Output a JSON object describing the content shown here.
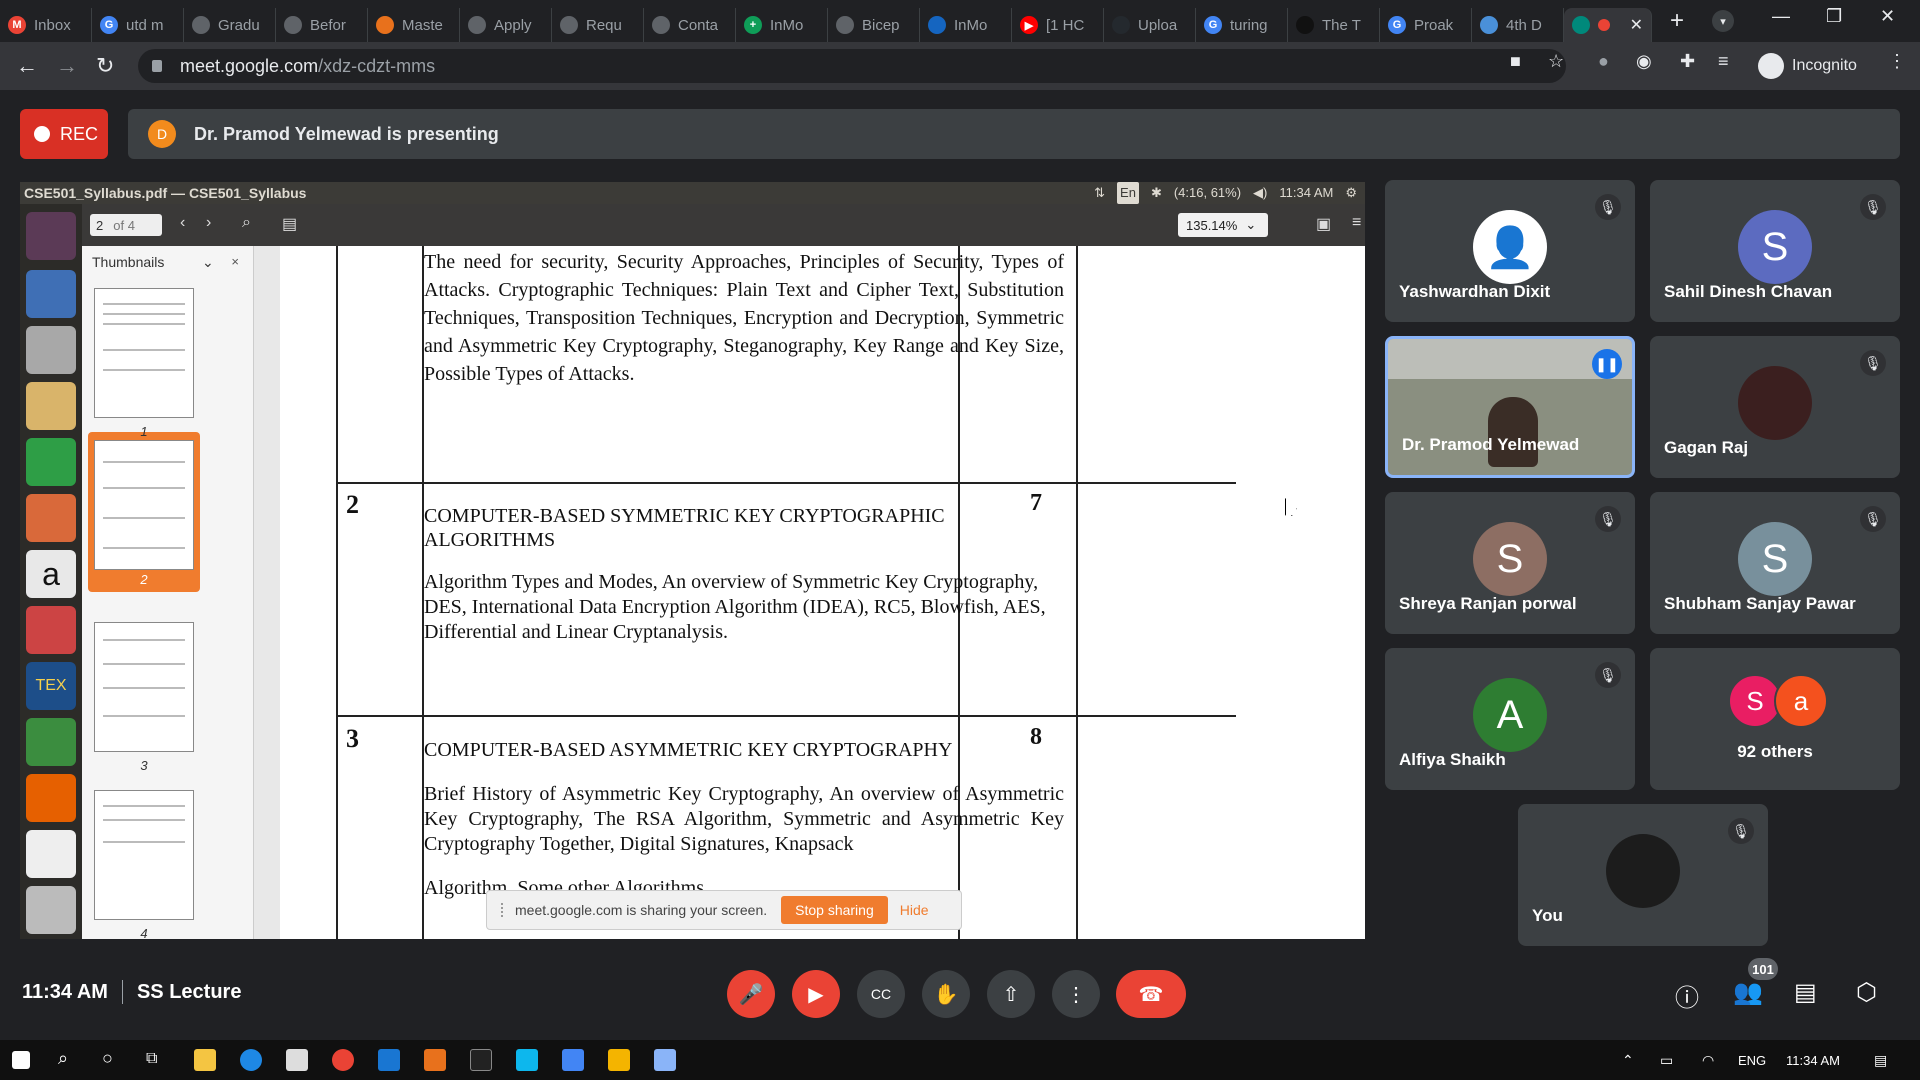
{
  "browser": {
    "tabs": [
      {
        "label": "Inbox",
        "fav": "M",
        "color": "#ea4335"
      },
      {
        "label": "utd m",
        "fav": "G",
        "color": "#4285f4"
      },
      {
        "label": "Gradu",
        "fav": "",
        "color": "#5f6368"
      },
      {
        "label": "Befor",
        "fav": "",
        "color": "#5f6368"
      },
      {
        "label": "Maste",
        "fav": "",
        "color": "#e8711c"
      },
      {
        "label": "Apply",
        "fav": "",
        "color": "#5f6368"
      },
      {
        "label": "Requ",
        "fav": "",
        "color": "#5f6368"
      },
      {
        "label": "Conta",
        "fav": "",
        "color": "#5f6368"
      },
      {
        "label": "InMo",
        "fav": "+",
        "color": "#0f9d58"
      },
      {
        "label": "Bicep",
        "fav": "",
        "color": "#5f6368"
      },
      {
        "label": "InMo",
        "fav": "",
        "color": "#1565c0"
      },
      {
        "label": "[1 HC",
        "fav": "▶",
        "color": "#ff0000"
      },
      {
        "label": "Uploa",
        "fav": "",
        "color": "#24292e"
      },
      {
        "label": "turing",
        "fav": "G",
        "color": "#4285f4"
      },
      {
        "label": "The T",
        "fav": "",
        "color": "#111111"
      },
      {
        "label": "Proak",
        "fav": "G",
        "color": "#4285f4"
      },
      {
        "label": "4th D",
        "fav": "",
        "color": "#4a90d9"
      }
    ],
    "active_tab_color": "#00897b",
    "url_host": "meet.google.com",
    "url_path": "/xdz-cdzt-mms",
    "incognito_label": "Incognito"
  },
  "meet": {
    "rec_label": "REC",
    "presenter_initial": "D",
    "presenting_text": "Dr. Pramod Yelmewad is presenting",
    "time": "11:34 AM",
    "meeting_name": "SS Lecture",
    "participant_count": "101"
  },
  "shared_screen": {
    "window_title": "CSE501_Syllabus.pdf — CSE501_Syllabus",
    "status_battery": "(4:16, 61%)",
    "status_lang": "En",
    "status_time": "11:34 AM",
    "page_current": "2",
    "page_of": "of 4",
    "zoom": "135.14%",
    "sidebar_title": "Thumbnails",
    "thumbnails": [
      "1",
      "2",
      "3",
      "4"
    ],
    "doc": {
      "row1_text": "The need for security, Security Approaches, Principles of Security, Types of Attacks. Cryptographic Techniques: Plain Text and Cipher Text, Substitution Techniques, Transposition Techniques, Encryption and Decryption, Symmetric and Asymmetric Key Cryptography, Steganography, Key Range and Key Size, Possible Types of Attacks.",
      "row2_num": "2",
      "row2_title": "COMPUTER-BASED SYMMETRIC KEY CRYPTOGRAPHIC ALGORITHMS",
      "row2_text": "Algorithm Types and Modes, An overview of Symmetric Key Cryptography, DES, International Data Encryption Algorithm (IDEA), RC5, Blowfish, AES, Differential and Linear Cryptanalysis.",
      "row2_hours": "7",
      "row3_num": "3",
      "row3_title": "COMPUTER-BASED ASYMMETRIC KEY CRYPTOGRAPHY",
      "row3_text": "Brief History of Asymmetric Key Cryptography, An overview of Asymmetric Key Cryptography, The RSA Algorithm, Symmetric and Asymmetric Key Cryptography Together, Digital Signatures, Knapsack",
      "row3_text2": "Algorithm, Some other Algorithms",
      "row3_hours": "8"
    },
    "sharing_text": "meet.google.com is sharing your screen.",
    "stop_sharing": "Stop sharing",
    "hide": "Hide"
  },
  "participants": [
    {
      "name": "Yashwardhan Dixit",
      "initial": "",
      "color": "#ffffff"
    },
    {
      "name": "Sahil Dinesh Chavan",
      "initial": "S",
      "color": "#5c6bc0"
    },
    {
      "name": "Dr. Pramod Yelmewad",
      "initial": "",
      "color": "#8a8f80"
    },
    {
      "name": "Gagan Raj",
      "initial": "",
      "color": "#3b1f1f"
    },
    {
      "name": "Shreya Ranjan porwal",
      "initial": "S",
      "color": "#8d6e63"
    },
    {
      "name": "Shubham Sanjay Pawar",
      "initial": "S",
      "color": "#78909c"
    },
    {
      "name": "Alfiya Shaikh",
      "initial": "A",
      "color": "#2e7d32"
    },
    {
      "name": "You",
      "initial": "",
      "color": "#1c1c1c"
    }
  ],
  "others": {
    "label": "92 others",
    "a1": "S",
    "a1_color": "#e91e63",
    "a2": "a",
    "a2_color": "#f4511e"
  },
  "taskbar": {
    "lang": "ENG",
    "time": "11:34 AM"
  }
}
